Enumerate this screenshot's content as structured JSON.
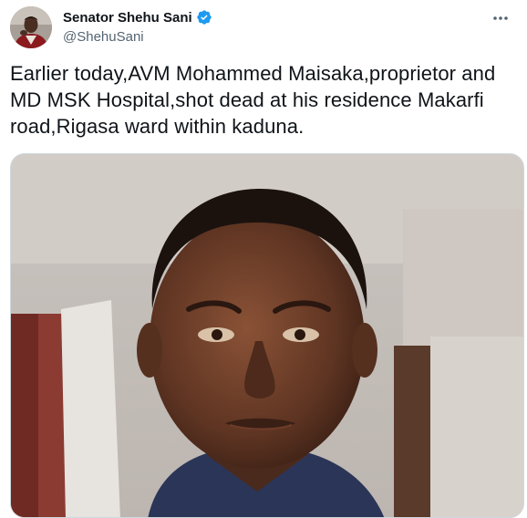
{
  "tweet": {
    "display_name": "Senator Shehu Sani",
    "handle": "@ShehuSani",
    "verified": true,
    "text": "Earlier today,AVM Mohammed Maisaka,proprietor and MD MSK Hospital,shot dead at his residence Makarfi road,Rigasa ward within kaduna.",
    "more_icon": "more-horizontal-icon"
  },
  "colors": {
    "verified_blue": "#1d9bf0",
    "secondary_text": "#536471",
    "primary_text": "#0f1419"
  }
}
